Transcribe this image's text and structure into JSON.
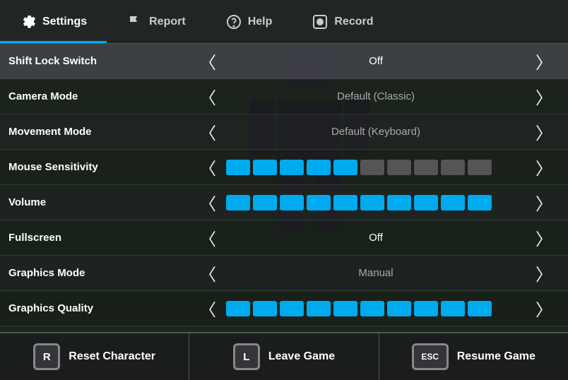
{
  "nav": {
    "items": [
      {
        "id": "settings",
        "label": "Settings",
        "active": true,
        "icon": "gear"
      },
      {
        "id": "report",
        "label": "Report",
        "active": false,
        "icon": "flag"
      },
      {
        "id": "help",
        "label": "Help",
        "active": false,
        "icon": "question"
      },
      {
        "id": "record",
        "label": "Record",
        "active": false,
        "icon": "record"
      }
    ]
  },
  "settings": {
    "rows": [
      {
        "id": "shift-lock",
        "label": "Shift Lock Switch",
        "type": "option",
        "value": "Off",
        "valueBright": true
      },
      {
        "id": "camera-mode",
        "label": "Camera Mode",
        "type": "option",
        "value": "Default (Classic)",
        "valueBright": false
      },
      {
        "id": "movement-mode",
        "label": "Movement Mode",
        "type": "option",
        "value": "Default (Keyboard)",
        "valueBright": false
      },
      {
        "id": "mouse-sensitivity",
        "label": "Mouse Sensitivity",
        "type": "slider",
        "filled": 5,
        "total": 10
      },
      {
        "id": "volume",
        "label": "Volume",
        "type": "slider",
        "filled": 10,
        "total": 10
      },
      {
        "id": "fullscreen",
        "label": "Fullscreen",
        "type": "option",
        "value": "Off",
        "valueBright": true
      },
      {
        "id": "graphics-mode",
        "label": "Graphics Mode",
        "type": "option",
        "value": "Manual",
        "valueBright": false
      },
      {
        "id": "graphics-quality",
        "label": "Graphics Quality",
        "type": "slider",
        "filled": 10,
        "total": 10
      }
    ]
  },
  "bottomBar": {
    "buttons": [
      {
        "id": "reset-character",
        "key": "R",
        "label": "Reset Character"
      },
      {
        "id": "leave-game",
        "key": "L",
        "label": "Leave Game"
      },
      {
        "id": "resume-game",
        "key": "ESC",
        "label": "Resume Game"
      }
    ]
  },
  "arrows": {
    "left": "‹",
    "right": "›"
  }
}
